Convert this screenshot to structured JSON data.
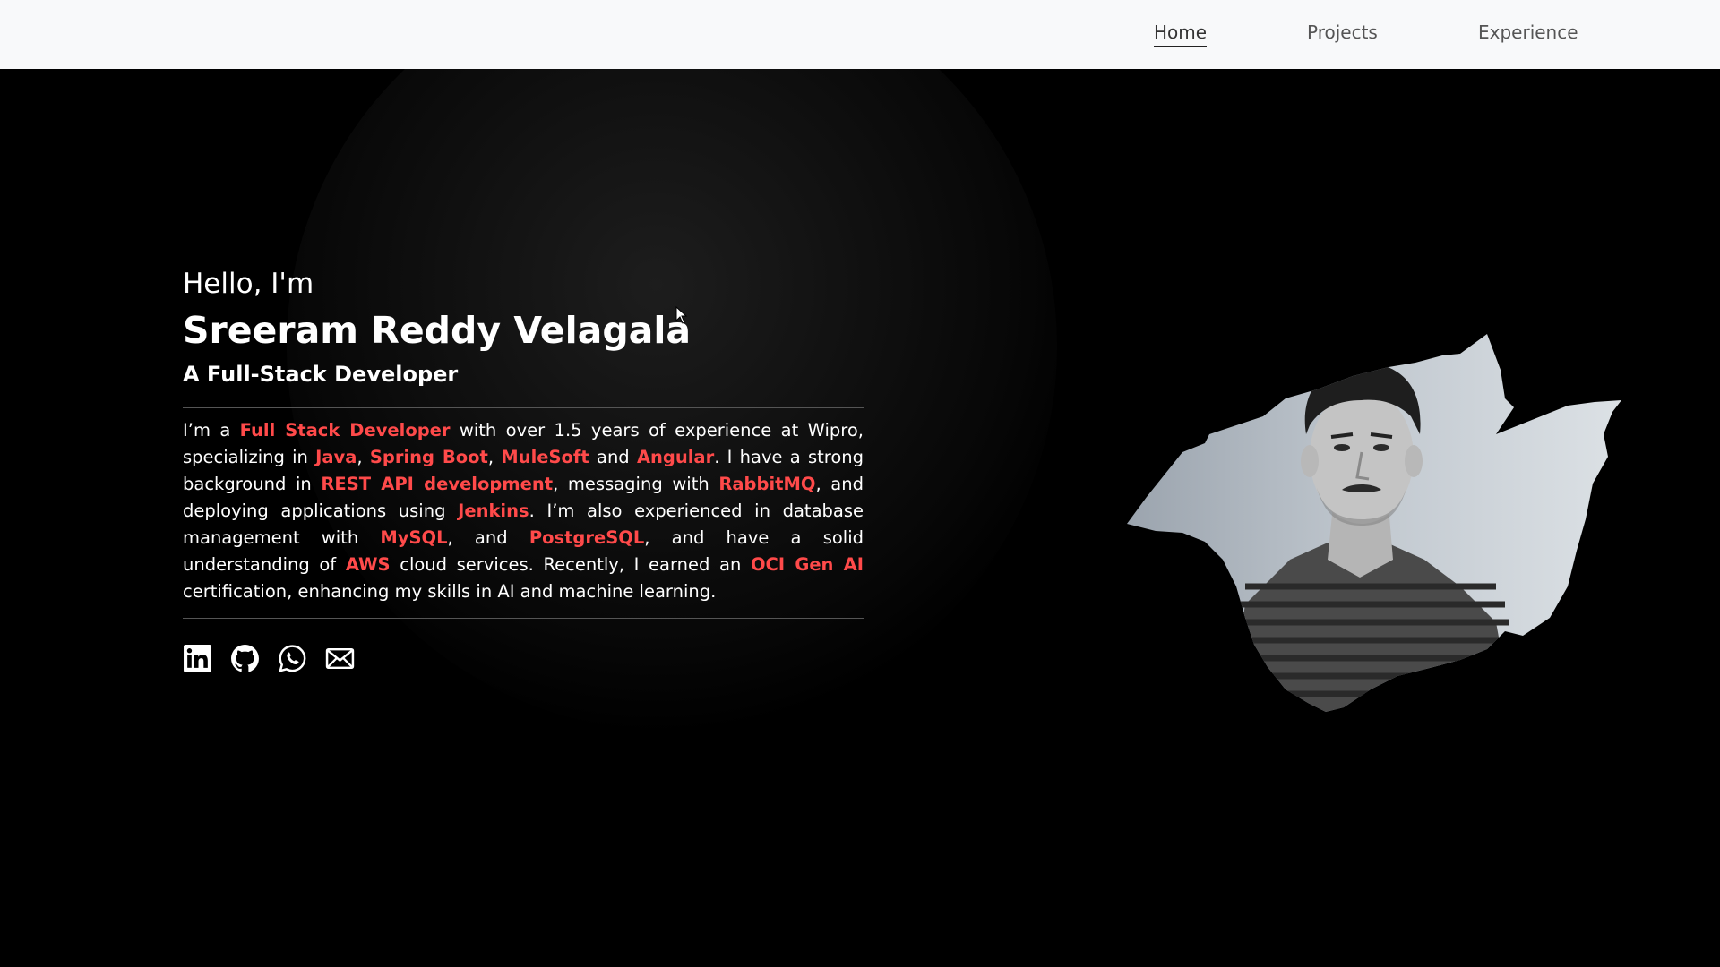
{
  "nav": {
    "items": [
      {
        "label": "Home",
        "active": true
      },
      {
        "label": "Projects",
        "active": false
      },
      {
        "label": "Experience",
        "active": false
      }
    ]
  },
  "hero": {
    "greeting": "Hello, I'm",
    "name": "Sreeram Reddy Velagala",
    "role": "A Full-Stack Developer",
    "bio": [
      {
        "t": "I’m a "
      },
      {
        "t": "Full Stack Developer",
        "hl": true
      },
      {
        "t": " with over 1.5 years of experience at Wipro, specializing in "
      },
      {
        "t": "Java",
        "hl": true
      },
      {
        "t": ", "
      },
      {
        "t": "Spring Boot",
        "hl": true
      },
      {
        "t": ", "
      },
      {
        "t": "MuleSoft",
        "hl": true
      },
      {
        "t": " and "
      },
      {
        "t": "Angular",
        "hl": true
      },
      {
        "t": ". I have a strong background in "
      },
      {
        "t": "REST API development",
        "hl": true
      },
      {
        "t": ", messaging with "
      },
      {
        "t": "RabbitMQ",
        "hl": true
      },
      {
        "t": ", and deploying applications using "
      },
      {
        "t": "Jenkins",
        "hl": true
      },
      {
        "t": ". I’m also experienced in database management with "
      },
      {
        "t": "MySQL",
        "hl": true
      },
      {
        "t": ", and "
      },
      {
        "t": "PostgreSQL",
        "hl": true
      },
      {
        "t": ", and have a solid understanding of "
      },
      {
        "t": "AWS",
        "hl": true
      },
      {
        "t": " cloud services. Recently, I earned an "
      },
      {
        "t": "OCI Gen AI",
        "hl": true
      },
      {
        "t": " certification, enhancing my skills in AI and machine learning."
      }
    ],
    "socials": [
      "linkedin-icon",
      "github-icon",
      "whatsapp-icon",
      "mail-icon"
    ]
  },
  "colors": {
    "navbar_bg": "#f8f9fa",
    "page_bg": "#000000",
    "accent": "#ff4a4a",
    "text": "#ffffff"
  }
}
